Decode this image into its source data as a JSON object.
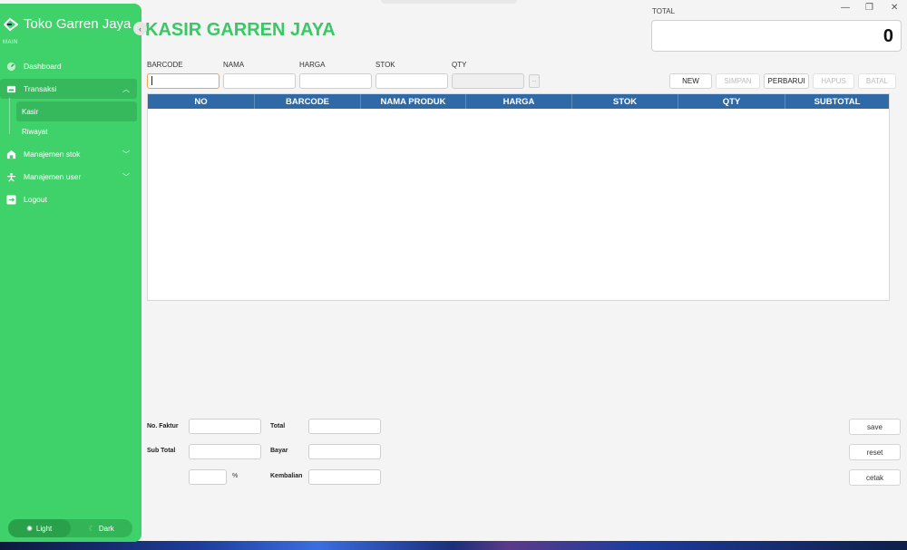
{
  "app": {
    "brand": "Toko Garren Jaya",
    "section_label": "MAIN",
    "page_title": "KASIR GARREN JAYA"
  },
  "sidebar": {
    "items": [
      {
        "label": "Dashboard",
        "icon": "dashboard-icon"
      },
      {
        "label": "Transaksi",
        "icon": "inbox-icon",
        "expanded": true,
        "children": [
          {
            "label": "Kasir",
            "selected": true
          },
          {
            "label": "Riwayat"
          }
        ]
      },
      {
        "label": "Manajemen stok",
        "icon": "warehouse-icon"
      },
      {
        "label": "Manajemen user",
        "icon": "user-icon"
      },
      {
        "label": "Logout",
        "icon": "logout-icon"
      }
    ],
    "theme": {
      "light": "Light",
      "dark": "Dark",
      "selected": "Light"
    }
  },
  "total": {
    "label": "TOTAL",
    "value": "0"
  },
  "form": {
    "barcode_label": "BARCODE",
    "nama_label": "NAMA",
    "harga_label": "HARGA",
    "stok_label": "STOK",
    "qty_label": "QTY",
    "dots": "..."
  },
  "toolbar": {
    "new": "NEW",
    "simpan": "SIMPAN",
    "perbarui": "PERBARUI",
    "hapus": "HAPUS",
    "batal": "BATAL"
  },
  "table": {
    "columns": [
      "NO",
      "BARCODE",
      "NAMA PRODUK",
      "HARGA",
      "STOK",
      "QTY",
      "SUBTOTAL"
    ],
    "rows": []
  },
  "footer": {
    "no_faktur": "No. Faktur",
    "sub_total": "Sub Total",
    "total": "Total",
    "bayar": "Bayar",
    "kembalian": "Kembalian",
    "percent": "%",
    "save": "save",
    "reset": "reset",
    "cetak": "cetak"
  },
  "colors": {
    "sidebar": "#3fd26a",
    "accent": "#37c964",
    "table_header": "#2f6aa6"
  }
}
